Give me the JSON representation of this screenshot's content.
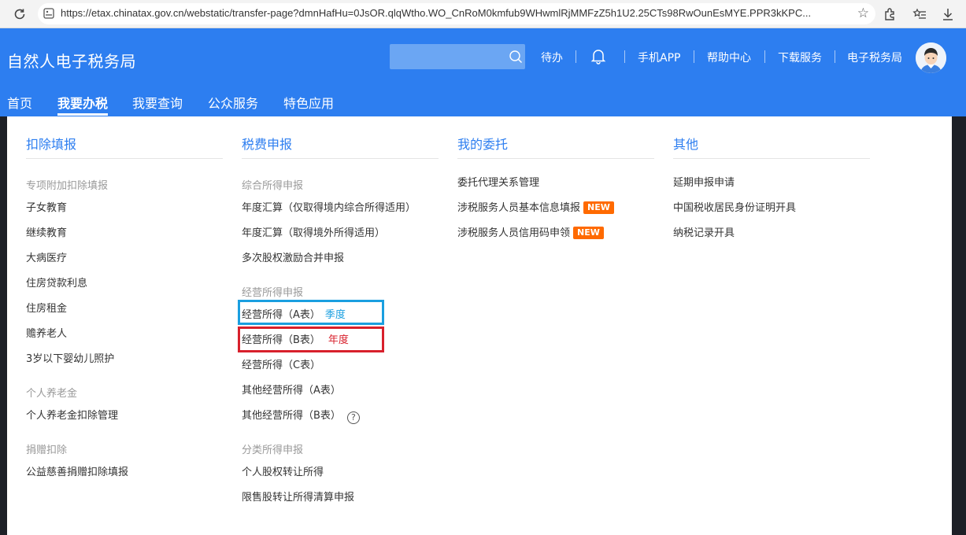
{
  "browser": {
    "url": "https://etax.chinatax.gov.cn/webstatic/transfer-page?dmnHafHu=0JsOR.qlqWtho.WO_CnRoM0kmfub9WHwmlRjMMFzZ5h1U2.25CTs98RwOunEsMYE.PPR3kKPC..."
  },
  "header": {
    "title": "自然人电子税务局",
    "search_placeholder": "",
    "links": {
      "todo": "待办",
      "mobile_app": "手机APP",
      "help_center": "帮助中心",
      "download": "下载服务",
      "etax_bureau": "电子税务局"
    },
    "nav": [
      "首页",
      "我要办税",
      "我要查询",
      "公众服务",
      "特色应用"
    ]
  },
  "menu": {
    "col1": {
      "title": "扣除填报",
      "sections": [
        {
          "title": "专项附加扣除填报",
          "items": [
            "子女教育",
            "继续教育",
            "大病医疗",
            "住房贷款利息",
            "住房租金",
            "赡养老人",
            "3岁以下婴幼儿照护"
          ]
        },
        {
          "title": "个人养老金",
          "items": [
            "个人养老金扣除管理"
          ]
        },
        {
          "title": "捐赠扣除",
          "items": [
            "公益慈善捐赠扣除填报"
          ]
        }
      ]
    },
    "col2": {
      "title": "税费申报",
      "sections": [
        {
          "title": "综合所得申报",
          "items": [
            "年度汇算（仅取得境内综合所得适用）",
            "年度汇算（取得境外所得适用）",
            "多次股权激励合并申报"
          ]
        },
        {
          "title": "经营所得申报",
          "items": [
            "经营所得（A表）",
            "经营所得（B表）",
            "经营所得（C表）",
            "其他经营所得（A表）",
            "其他经营所得（B表）"
          ]
        },
        {
          "title": "分类所得申报",
          "items": [
            "个人股权转让所得",
            "限售股转让所得清算申报"
          ]
        }
      ]
    },
    "col3": {
      "title": "我的委托",
      "items": [
        "委托代理关系管理",
        "涉税服务人员基本信息填报",
        "涉税服务人员信用码申领"
      ],
      "badge": "NEW"
    },
    "col4": {
      "title": "其他",
      "items": [
        "延期申报申请",
        "中国税收居民身份证明开具",
        "纳税记录开具"
      ]
    },
    "annotations": {
      "quarterly": "季度",
      "annual": "年度"
    }
  },
  "colors": {
    "header_blue": "#2d7ef0",
    "badge_orange": "#ff6a00",
    "highlight_blue": "#1a9fe0",
    "highlight_red": "#d8202c"
  }
}
